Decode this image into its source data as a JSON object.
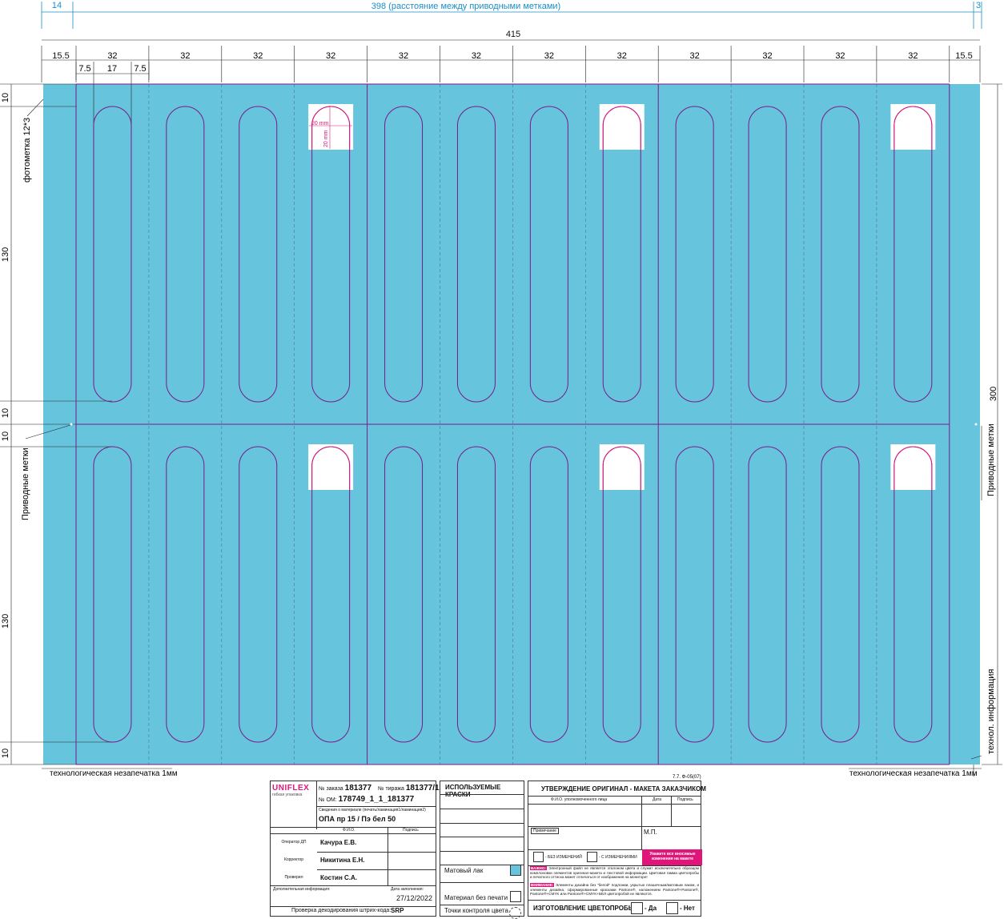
{
  "dimensions": {
    "left_offset": "14",
    "pitch_label": "398 (расстояние между приводными метками)",
    "right_offset": "3",
    "total_width": "415",
    "margin_left": "15.5",
    "margin_right": "15.5",
    "lane_width": "32",
    "small_dims": [
      "7.5",
      "17",
      "7.5"
    ],
    "left_vertical": [
      "10",
      "130",
      "10",
      "10",
      "130",
      "10"
    ],
    "right_height": "300",
    "window_w": "20 mm",
    "window_h": "20 mm"
  },
  "labels": {
    "photomark": "фотометка 12*3",
    "drive_marks_left": "Приводные метки",
    "drive_marks_right": "Приводные метки",
    "tech_info": "технол. информация",
    "unprinted_left": "технологическая незапечатка 1мм",
    "unprinted_right": "технологическая незапечатка 1мм",
    "form_code": "7.7. Ф-05(07)"
  },
  "colors": {
    "web_fill": "#66c4dd",
    "line_purple": "#7a1a8c",
    "magenta": "#e0157a",
    "dim_cyan": "#1a8fc6"
  },
  "order_panel": {
    "logo": "UNIFLEX",
    "logo_sub": "гибкая упаковка",
    "order_no_label": "№ заказа",
    "order_no": "181377",
    "run_no_label": "№ тиража",
    "run_no": "181377/1",
    "om_label": "№ ОМ:",
    "om_no": "178749_1_1_181377",
    "material_caption": "Сведения о материале (печать/ламинация1/ламинация2)",
    "material": "ОПА пр 15 / Пэ бел 50",
    "col_name": "Ф.И.О.",
    "col_sign": "Подпись",
    "rows": [
      {
        "role": "Оператор ДП",
        "name": "Качура Е.В."
      },
      {
        "role": "Корректор",
        "name": "Никитина Е.Н."
      },
      {
        "role": "Проверил",
        "name": "Костин С.А."
      }
    ],
    "extra_info": "Дополнительная информация:",
    "fill_date_label": "Дата заполнения:",
    "fill_date": "27/12/2022",
    "barcode_check": "Проверка декодирования штрих-кода:",
    "barcode_value": "SRP"
  },
  "inks_panel": {
    "title": "ИСПОЛЬЗУЕМЫЕ КРАСКИ",
    "matte_varnish": "Матовый лак",
    "no_print_material": "Материал без печати",
    "color_control_points": "Точки контроля цвета"
  },
  "approval_panel": {
    "title": "УТВЕРЖДЕНИЕ ОРИГИНАЛ - МАКЕТА ЗАКАЗЧИКОМ",
    "col_person": "Ф.И.О. уполномоченного лица",
    "col_date": "Дата",
    "col_sign": "Подпись",
    "notes": "Примечание",
    "stamp": "М.П.",
    "no_changes": "- БЕЗ ИЗМЕНЕНИЙ",
    "with_changes": "- С ИЗМЕНЕНИЯМИ",
    "specify_changes": "Укажите все вносимые изменения на макете",
    "important_tag": "ВАЖНО:",
    "important_text": "Электронный файл не является эталоном цвета и служит исключительно образцом комплоновки элементов оригинал-макета и текстовой информации. Цветовая гамма цветопробы и печатного оттиска может отличаться от изображения на мониторе!",
    "attention_tag": "ВНИМАНИЕ:",
    "attention_text": "Элементы дизайна без \"белой\" подложки, укрытые плашечным/матовым лаком, и элементы дизайна, сформированные красками Pantone®, наложением Pantone®+Pantone®, Pantone®+CMYK или Pantone®+CMYK+БЕЛ цветопробой не являются.",
    "proof_label": "ИЗГОТОВЛЕНИЕ ЦВЕТОПРОБЫ:",
    "yes": "- Да",
    "no": "- Нет"
  }
}
